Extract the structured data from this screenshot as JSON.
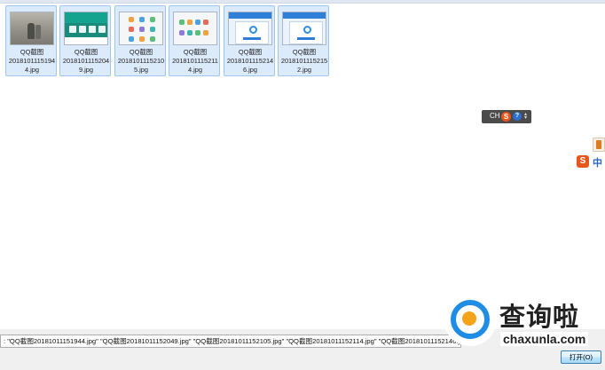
{
  "files": [
    {
      "name_line1": "QQ截图",
      "name_line2": "2018101115194",
      "name_line3": "4.jpg",
      "thumb_icon": "photo-thumbnail"
    },
    {
      "name_line1": "QQ截图",
      "name_line2": "2018101115204",
      "name_line3": "9.jpg",
      "thumb_icon": "app-screenshot-thumbnail"
    },
    {
      "name_line1": "QQ截图",
      "name_line2": "2018101115210",
      "name_line3": "5.jpg",
      "thumb_icon": "app-screenshot-thumbnail"
    },
    {
      "name_line1": "QQ截图",
      "name_line2": "2018101115211",
      "name_line3": "4.jpg",
      "thumb_icon": "app-screenshot-thumbnail"
    },
    {
      "name_line1": "QQ截图",
      "name_line2": "2018101115214",
      "name_line3": "6.jpg",
      "thumb_icon": "app-screenshot-thumbnail"
    },
    {
      "name_line1": "QQ截图",
      "name_line2": "2018101115215",
      "name_line3": "2.jpg",
      "thumb_icon": "app-screenshot-thumbnail"
    }
  ],
  "ime_toolbar": {
    "lang": "CH",
    "sogou_glyph": "S",
    "help_glyph": "?"
  },
  "ime_side": {
    "sogou_glyph": "S",
    "mode_label": "中"
  },
  "filename_field": {
    "value": ": \"QQ截图20181011151944.jpg\" \"QQ截图20181011152049.jpg\" \"QQ截图20181011152105.jpg\" \"QQ截图20181011152114.jpg\" \"QQ截图20181011152146.jpg\" \"QQ截"
  },
  "buttons": {
    "open": "打开(O)"
  },
  "watermark": {
    "title": "查询啦",
    "url": "chaxunla.com"
  },
  "colors": {
    "selection_fill": "#dcebfc",
    "selection_border": "#9ec6ee",
    "watermark_blue": "#1f8ce6",
    "watermark_orange": "#f7a31a"
  }
}
